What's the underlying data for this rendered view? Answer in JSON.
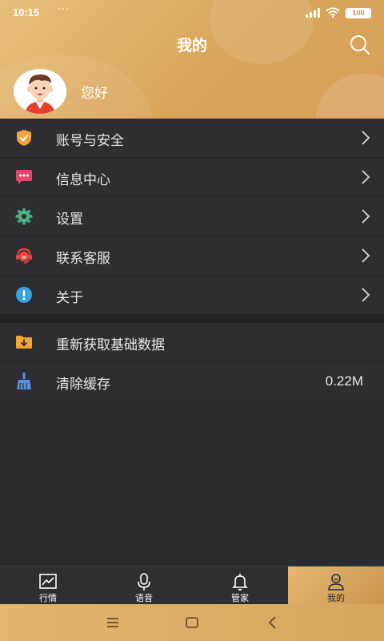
{
  "status_bar": {
    "time": "10:15",
    "dots": "···",
    "battery": "100"
  },
  "header": {
    "title": "我的",
    "greeting": "您好"
  },
  "menu": {
    "group1": [
      {
        "label": "账号与安全",
        "icon": "shield-check-icon"
      },
      {
        "label": "信息中心",
        "icon": "message-icon"
      },
      {
        "label": "设置",
        "icon": "gear-icon"
      },
      {
        "label": "联系客服",
        "icon": "headset-icon"
      },
      {
        "label": "关于",
        "icon": "info-icon"
      }
    ],
    "group2": [
      {
        "label": "重新获取基础数据",
        "icon": "folder-download-icon"
      },
      {
        "label": "清除缓存",
        "icon": "broom-icon",
        "value": "0.22M"
      }
    ]
  },
  "bottom_nav": {
    "tabs": [
      {
        "label": "行情",
        "icon": "chart-icon"
      },
      {
        "label": "语音",
        "icon": "microphone-icon"
      },
      {
        "label": "管家",
        "icon": "bell-icon"
      },
      {
        "label": "我的",
        "icon": "user-icon",
        "active": true
      }
    ]
  },
  "colors": {
    "accent": "#d9a55b",
    "background": "#2a2b30",
    "row": "#2d2e33"
  }
}
